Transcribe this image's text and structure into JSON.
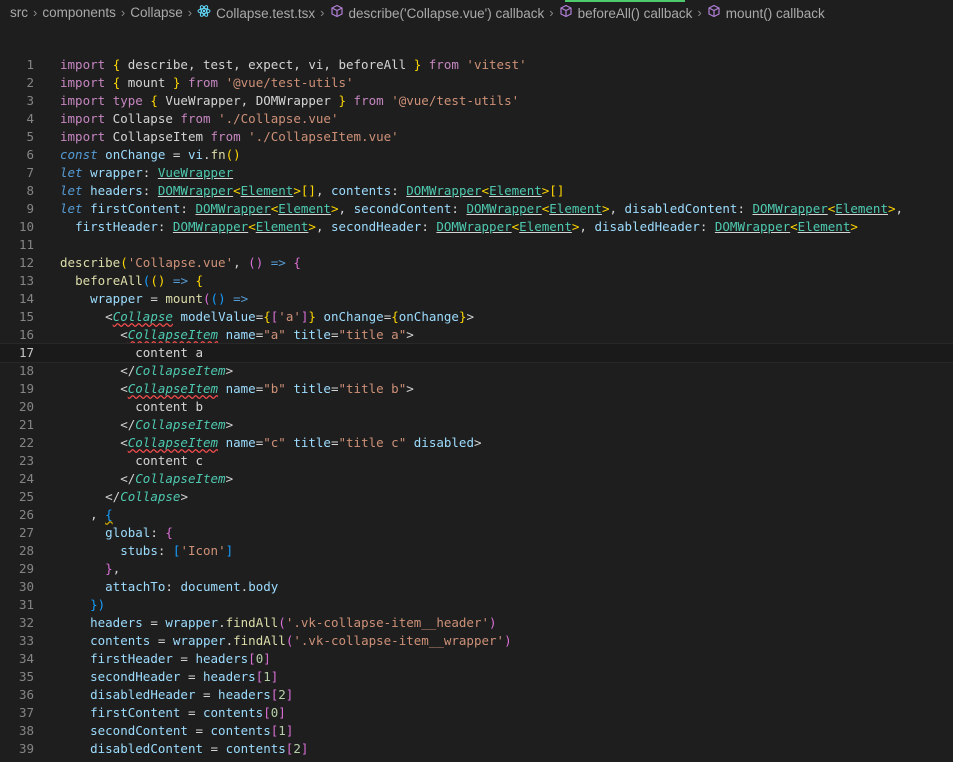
{
  "breadcrumb": {
    "items": [
      {
        "label": "src",
        "icon": null
      },
      {
        "label": "components",
        "icon": null
      },
      {
        "label": "Collapse",
        "icon": null
      },
      {
        "label": "Collapse.test.tsx",
        "icon": "react-icon"
      },
      {
        "label": "describe('Collapse.vue') callback",
        "icon": "cube-icon"
      },
      {
        "label": "beforeAll() callback",
        "icon": "cube-icon"
      },
      {
        "label": "mount() callback",
        "icon": "cube-icon"
      }
    ]
  },
  "editor": {
    "current_line": 17,
    "colors": {
      "background": "#1e1e1e",
      "keyword": "#c586c0",
      "string": "#ce9178",
      "type": "#4ec9b0",
      "function": "#dcdcaa",
      "variable": "#9cdcfe",
      "number": "#b5cea8",
      "error_squiggle": "#f14c4c"
    },
    "lines": [
      [
        {
          "t": "import",
          "c": "kw"
        },
        {
          "t": " "
        },
        {
          "t": "{",
          "c": "b1"
        },
        {
          "t": " describe, test, expect, vi, beforeAll "
        },
        {
          "t": "}",
          "c": "b1"
        },
        {
          "t": " "
        },
        {
          "t": "from",
          "c": "kw"
        },
        {
          "t": " "
        },
        {
          "t": "'vitest'",
          "c": "str"
        }
      ],
      [
        {
          "t": "import",
          "c": "kw"
        },
        {
          "t": " "
        },
        {
          "t": "{",
          "c": "b1"
        },
        {
          "t": " mount "
        },
        {
          "t": "}",
          "c": "b1"
        },
        {
          "t": " "
        },
        {
          "t": "from",
          "c": "kw"
        },
        {
          "t": " "
        },
        {
          "t": "'@vue/test-utils'",
          "c": "str"
        }
      ],
      [
        {
          "t": "import",
          "c": "kw"
        },
        {
          "t": " "
        },
        {
          "t": "type",
          "c": "kw"
        },
        {
          "t": " "
        },
        {
          "t": "{",
          "c": "b1"
        },
        {
          "t": " VueWrapper, DOMWrapper "
        },
        {
          "t": "}",
          "c": "b1"
        },
        {
          "t": " "
        },
        {
          "t": "from",
          "c": "kw"
        },
        {
          "t": " "
        },
        {
          "t": "'@vue/test-utils'",
          "c": "str"
        }
      ],
      [
        {
          "t": "import",
          "c": "kw"
        },
        {
          "t": " Collapse "
        },
        {
          "t": "from",
          "c": "kw"
        },
        {
          "t": " "
        },
        {
          "t": "'./Collapse.vue'",
          "c": "str"
        }
      ],
      [
        {
          "t": "import",
          "c": "kw"
        },
        {
          "t": " CollapseItem "
        },
        {
          "t": "from",
          "c": "kw"
        },
        {
          "t": " "
        },
        {
          "t": "'./CollapseItem.vue'",
          "c": "str"
        }
      ],
      [
        {
          "t": "const",
          "c": "kw2"
        },
        {
          "t": " "
        },
        {
          "t": "onChange",
          "c": "var"
        },
        {
          "t": " = "
        },
        {
          "t": "vi",
          "c": "var"
        },
        {
          "t": "."
        },
        {
          "t": "fn",
          "c": "fn"
        },
        {
          "t": "()",
          "c": "b1"
        }
      ],
      [
        {
          "t": "let",
          "c": "kw2"
        },
        {
          "t": " "
        },
        {
          "t": "wrapper",
          "c": "var"
        },
        {
          "t": ": "
        },
        {
          "t": "VueWrapper",
          "c": "typ ul"
        }
      ],
      [
        {
          "t": "let",
          "c": "kw2"
        },
        {
          "t": " "
        },
        {
          "t": "headers",
          "c": "var"
        },
        {
          "t": ": "
        },
        {
          "t": "DOMWrapper",
          "c": "typ ul"
        },
        {
          "t": "<",
          "c": "b1"
        },
        {
          "t": "Element",
          "c": "typ ul"
        },
        {
          "t": ">",
          "c": "b1"
        },
        {
          "t": "[]",
          "c": "b1"
        },
        {
          "t": ", "
        },
        {
          "t": "contents",
          "c": "var"
        },
        {
          "t": ": "
        },
        {
          "t": "DOMWrapper",
          "c": "typ ul"
        },
        {
          "t": "<",
          "c": "b1"
        },
        {
          "t": "Element",
          "c": "typ ul"
        },
        {
          "t": ">",
          "c": "b1"
        },
        {
          "t": "[]",
          "c": "b1"
        }
      ],
      [
        {
          "t": "let",
          "c": "kw2"
        },
        {
          "t": " "
        },
        {
          "t": "firstContent",
          "c": "var"
        },
        {
          "t": ": "
        },
        {
          "t": "DOMWrapper",
          "c": "typ ul"
        },
        {
          "t": "<",
          "c": "b1"
        },
        {
          "t": "Element",
          "c": "typ ul"
        },
        {
          "t": ">",
          "c": "b1"
        },
        {
          "t": ", "
        },
        {
          "t": "secondContent",
          "c": "var"
        },
        {
          "t": ": "
        },
        {
          "t": "DOMWrapper",
          "c": "typ ul"
        },
        {
          "t": "<",
          "c": "b1"
        },
        {
          "t": "Element",
          "c": "typ ul"
        },
        {
          "t": ">",
          "c": "b1"
        },
        {
          "t": ", "
        },
        {
          "t": "disabledContent",
          "c": "var"
        },
        {
          "t": ": "
        },
        {
          "t": "DOMWrapper",
          "c": "typ ul"
        },
        {
          "t": "<",
          "c": "b1"
        },
        {
          "t": "Element",
          "c": "typ ul"
        },
        {
          "t": ">",
          "c": "b1"
        },
        {
          "t": ","
        }
      ],
      [
        {
          "t": "  "
        },
        {
          "t": "firstHeader",
          "c": "var"
        },
        {
          "t": ": "
        },
        {
          "t": "DOMWrapper",
          "c": "typ ul"
        },
        {
          "t": "<",
          "c": "b1"
        },
        {
          "t": "Element",
          "c": "typ ul"
        },
        {
          "t": ">",
          "c": "b1"
        },
        {
          "t": ", "
        },
        {
          "t": "secondHeader",
          "c": "var"
        },
        {
          "t": ": "
        },
        {
          "t": "DOMWrapper",
          "c": "typ ul"
        },
        {
          "t": "<",
          "c": "b1"
        },
        {
          "t": "Element",
          "c": "typ ul"
        },
        {
          "t": ">",
          "c": "b1"
        },
        {
          "t": ", "
        },
        {
          "t": "disabledHeader",
          "c": "var"
        },
        {
          "t": ": "
        },
        {
          "t": "DOMWrapper",
          "c": "typ ul"
        },
        {
          "t": "<",
          "c": "b1"
        },
        {
          "t": "Element",
          "c": "typ ul"
        },
        {
          "t": ">",
          "c": "b1"
        }
      ],
      [],
      [
        {
          "t": "describe",
          "c": "fn"
        },
        {
          "t": "(",
          "c": "b1"
        },
        {
          "t": "'Collapse.vue'",
          "c": "str"
        },
        {
          "t": ", "
        },
        {
          "t": "()",
          "c": "b2"
        },
        {
          "t": " "
        },
        {
          "t": "=>",
          "c": "kw2"
        },
        {
          "t": " "
        },
        {
          "t": "{",
          "c": "b2"
        }
      ],
      [
        {
          "t": "  "
        },
        {
          "t": "beforeAll",
          "c": "fn"
        },
        {
          "t": "(",
          "c": "b3"
        },
        {
          "t": "()",
          "c": "b1"
        },
        {
          "t": " "
        },
        {
          "t": "=>",
          "c": "kw2"
        },
        {
          "t": " "
        },
        {
          "t": "{",
          "c": "b1"
        }
      ],
      [
        {
          "t": "    "
        },
        {
          "t": "wrapper",
          "c": "var"
        },
        {
          "t": " = "
        },
        {
          "t": "mount",
          "c": "fn"
        },
        {
          "t": "(",
          "c": "b2"
        },
        {
          "t": "()",
          "c": "b3"
        },
        {
          "t": " "
        },
        {
          "t": "=>",
          "c": "kw2"
        }
      ],
      [
        {
          "t": "      <"
        },
        {
          "t": "Collapse",
          "c": "tag sq"
        },
        {
          "t": " "
        },
        {
          "t": "modelValue",
          "c": "attr"
        },
        {
          "t": "="
        },
        {
          "t": "{",
          "c": "b1"
        },
        {
          "t": "[",
          "c": "b2"
        },
        {
          "t": "'a'",
          "c": "str"
        },
        {
          "t": "]",
          "c": "b2"
        },
        {
          "t": "}",
          "c": "b1"
        },
        {
          "t": " "
        },
        {
          "t": "onChange",
          "c": "attr"
        },
        {
          "t": "="
        },
        {
          "t": "{",
          "c": "b1"
        },
        {
          "t": "onChange",
          "c": "var"
        },
        {
          "t": "}",
          "c": "b1"
        },
        {
          "t": ">"
        }
      ],
      [
        {
          "t": "        <"
        },
        {
          "t": "CollapseItem",
          "c": "tag sq"
        },
        {
          "t": " "
        },
        {
          "t": "name",
          "c": "attr"
        },
        {
          "t": "="
        },
        {
          "t": "\"a\"",
          "c": "str"
        },
        {
          "t": " "
        },
        {
          "t": "title",
          "c": "attr"
        },
        {
          "t": "="
        },
        {
          "t": "\"title a\"",
          "c": "str"
        },
        {
          "t": ">"
        }
      ],
      [
        {
          "t": "          content a"
        }
      ],
      [
        {
          "t": "        </"
        },
        {
          "t": "CollapseItem",
          "c": "tag"
        },
        {
          "t": ">"
        }
      ],
      [
        {
          "t": "        <"
        },
        {
          "t": "CollapseItem",
          "c": "tag sq"
        },
        {
          "t": " "
        },
        {
          "t": "name",
          "c": "attr"
        },
        {
          "t": "="
        },
        {
          "t": "\"b\"",
          "c": "str"
        },
        {
          "t": " "
        },
        {
          "t": "title",
          "c": "attr"
        },
        {
          "t": "="
        },
        {
          "t": "\"title b\"",
          "c": "str"
        },
        {
          "t": ">"
        }
      ],
      [
        {
          "t": "          content b"
        }
      ],
      [
        {
          "t": "        </"
        },
        {
          "t": "CollapseItem",
          "c": "tag"
        },
        {
          "t": ">"
        }
      ],
      [
        {
          "t": "        <"
        },
        {
          "t": "CollapseItem",
          "c": "tag sq"
        },
        {
          "t": " "
        },
        {
          "t": "name",
          "c": "attr"
        },
        {
          "t": "="
        },
        {
          "t": "\"c\"",
          "c": "str"
        },
        {
          "t": " "
        },
        {
          "t": "title",
          "c": "attr"
        },
        {
          "t": "="
        },
        {
          "t": "\"title c\"",
          "c": "str"
        },
        {
          "t": " "
        },
        {
          "t": "disabled",
          "c": "attr"
        },
        {
          "t": ">"
        }
      ],
      [
        {
          "t": "          content c"
        }
      ],
      [
        {
          "t": "        </"
        },
        {
          "t": "CollapseItem",
          "c": "tag"
        },
        {
          "t": ">"
        }
      ],
      [
        {
          "t": "      </"
        },
        {
          "t": "Collapse",
          "c": "tag"
        },
        {
          "t": ">"
        }
      ],
      [
        {
          "t": "    , "
        },
        {
          "t": "{",
          "c": "b3 sqy"
        }
      ],
      [
        {
          "t": "      "
        },
        {
          "t": "global",
          "c": "var"
        },
        {
          "t": ": "
        },
        {
          "t": "{",
          "c": "b2"
        }
      ],
      [
        {
          "t": "        "
        },
        {
          "t": "stubs",
          "c": "var"
        },
        {
          "t": ": "
        },
        {
          "t": "[",
          "c": "b3"
        },
        {
          "t": "'Icon'",
          "c": "str"
        },
        {
          "t": "]",
          "c": "b3"
        }
      ],
      [
        {
          "t": "      "
        },
        {
          "t": "}",
          "c": "b2"
        },
        {
          "t": ","
        }
      ],
      [
        {
          "t": "      "
        },
        {
          "t": "attachTo",
          "c": "var"
        },
        {
          "t": ": "
        },
        {
          "t": "document",
          "c": "var"
        },
        {
          "t": "."
        },
        {
          "t": "body",
          "c": "var"
        }
      ],
      [
        {
          "t": "    "
        },
        {
          "t": "})",
          "c": "b3"
        }
      ],
      [
        {
          "t": "    "
        },
        {
          "t": "headers",
          "c": "var"
        },
        {
          "t": " = "
        },
        {
          "t": "wrapper",
          "c": "var"
        },
        {
          "t": "."
        },
        {
          "t": "findAll",
          "c": "fn"
        },
        {
          "t": "(",
          "c": "b2"
        },
        {
          "t": "'.vk-collapse-item__header'",
          "c": "str"
        },
        {
          "t": ")",
          "c": "b2"
        }
      ],
      [
        {
          "t": "    "
        },
        {
          "t": "contents",
          "c": "var"
        },
        {
          "t": " = "
        },
        {
          "t": "wrapper",
          "c": "var"
        },
        {
          "t": "."
        },
        {
          "t": "findAll",
          "c": "fn"
        },
        {
          "t": "(",
          "c": "b2"
        },
        {
          "t": "'.vk-collapse-item__wrapper'",
          "c": "str"
        },
        {
          "t": ")",
          "c": "b2"
        }
      ],
      [
        {
          "t": "    "
        },
        {
          "t": "firstHeader",
          "c": "var"
        },
        {
          "t": " = "
        },
        {
          "t": "headers",
          "c": "var"
        },
        {
          "t": "[",
          "c": "b2"
        },
        {
          "t": "0",
          "c": "num"
        },
        {
          "t": "]",
          "c": "b2"
        }
      ],
      [
        {
          "t": "    "
        },
        {
          "t": "secondHeader",
          "c": "var"
        },
        {
          "t": " = "
        },
        {
          "t": "headers",
          "c": "var"
        },
        {
          "t": "[",
          "c": "b2"
        },
        {
          "t": "1",
          "c": "num"
        },
        {
          "t": "]",
          "c": "b2"
        }
      ],
      [
        {
          "t": "    "
        },
        {
          "t": "disabledHeader",
          "c": "var"
        },
        {
          "t": " = "
        },
        {
          "t": "headers",
          "c": "var"
        },
        {
          "t": "[",
          "c": "b2"
        },
        {
          "t": "2",
          "c": "num"
        },
        {
          "t": "]",
          "c": "b2"
        }
      ],
      [
        {
          "t": "    "
        },
        {
          "t": "firstContent",
          "c": "var"
        },
        {
          "t": " = "
        },
        {
          "t": "contents",
          "c": "var"
        },
        {
          "t": "[",
          "c": "b2"
        },
        {
          "t": "0",
          "c": "num"
        },
        {
          "t": "]",
          "c": "b2"
        }
      ],
      [
        {
          "t": "    "
        },
        {
          "t": "secondContent",
          "c": "var"
        },
        {
          "t": " = "
        },
        {
          "t": "contents",
          "c": "var"
        },
        {
          "t": "[",
          "c": "b2"
        },
        {
          "t": "1",
          "c": "num"
        },
        {
          "t": "]",
          "c": "b2"
        }
      ],
      [
        {
          "t": "    "
        },
        {
          "t": "disabledContent",
          "c": "var"
        },
        {
          "t": " = "
        },
        {
          "t": "contents",
          "c": "var"
        },
        {
          "t": "[",
          "c": "b2"
        },
        {
          "t": "2",
          "c": "num"
        },
        {
          "t": "]",
          "c": "b2"
        }
      ]
    ]
  }
}
